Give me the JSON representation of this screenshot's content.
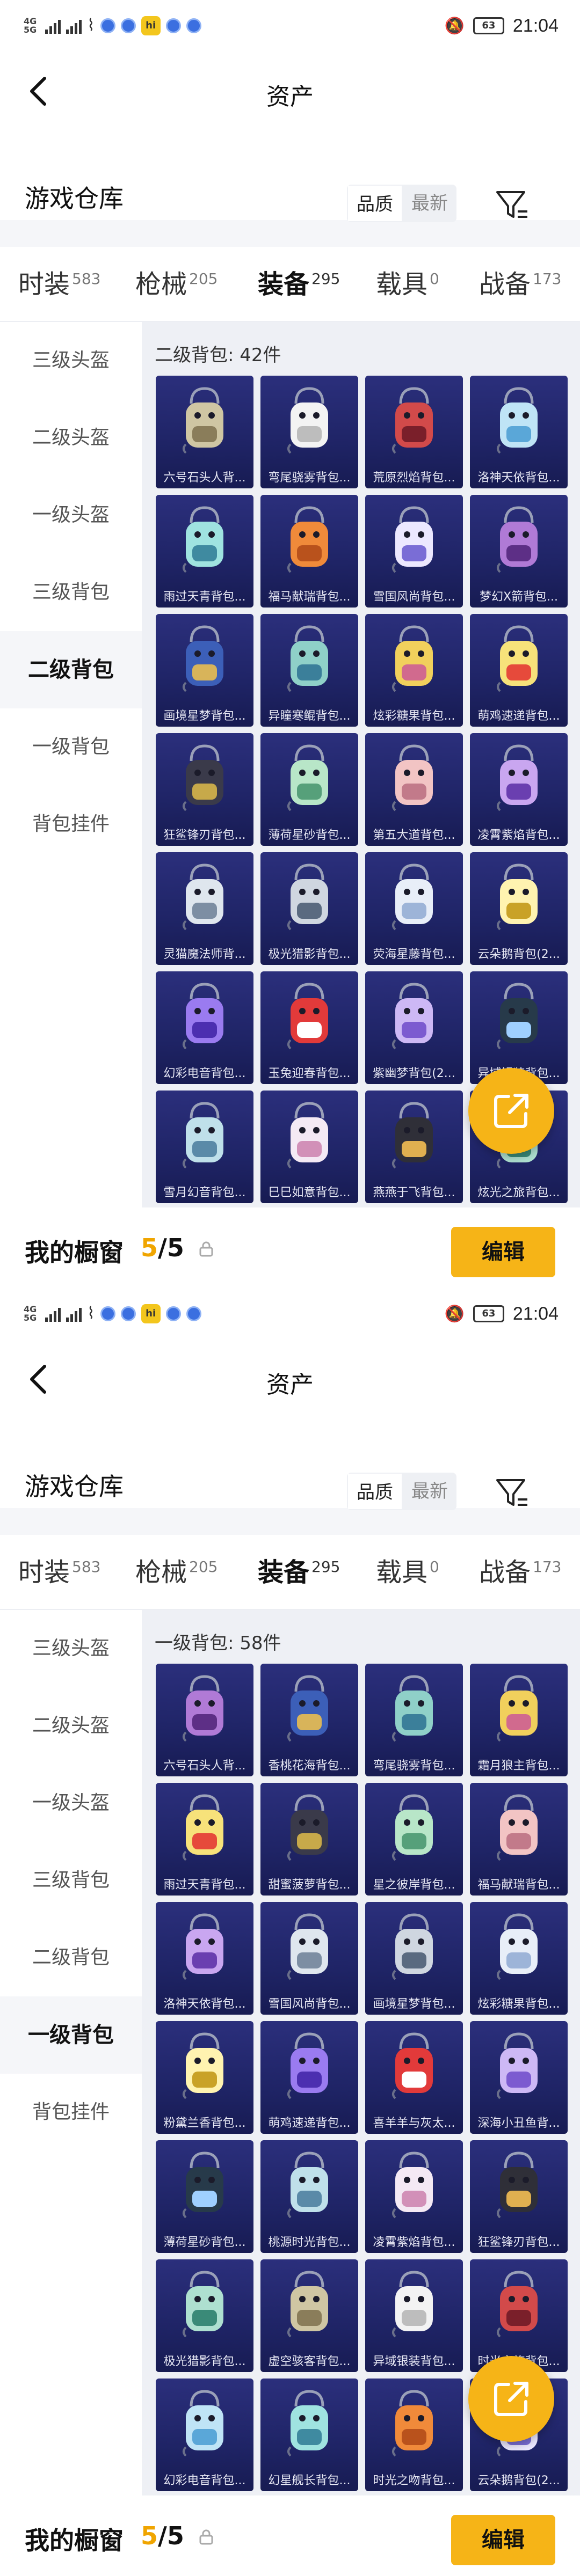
{
  "colors": {
    "accent": "#f6b417",
    "count_accent": "#f0a500",
    "card_top": "#2b2f7c",
    "card_bottom": "#171b52",
    "content_bg": "#eef0f5"
  },
  "screens": [
    {
      "status_bar": {
        "network": "4G 5G",
        "battery": "63",
        "time": "21:04",
        "app_icon_text": "hi"
      },
      "header": {
        "title": "资产",
        "back_icon": "chevron-left-icon"
      },
      "warehouse": {
        "title": "游戏仓库",
        "sort_options": [
          "品质",
          "最新"
        ],
        "sort_selected": "品质",
        "filter_icon": "filter-icon"
      },
      "tabs": [
        {
          "label": "时装",
          "count": "583"
        },
        {
          "label": "枪械",
          "count": "205"
        },
        {
          "label": "装备",
          "count": "295",
          "active": true
        },
        {
          "label": "载具",
          "count": "0"
        },
        {
          "label": "战备",
          "count": "173"
        }
      ],
      "side_nav": [
        {
          "label": "三级头盔"
        },
        {
          "label": "二级头盔"
        },
        {
          "label": "一级头盔"
        },
        {
          "label": "三级背包"
        },
        {
          "label": "二级背包",
          "active": true
        },
        {
          "label": "一级背包"
        },
        {
          "label": "背包挂件"
        }
      ],
      "category_label": "二级背包: 42件",
      "items": [
        "六号石头人背...",
        "弯尾骁雾背包...",
        "荒原烈焰背包...",
        "洛神天依背包...",
        "雨过天青背包...",
        "福马献瑞背包...",
        "雪国风尚背包...",
        "梦幻X箭背包...",
        "画境星梦背包...",
        "异瞳寒鲲背包...",
        "炫彩糖果背包...",
        "萌鸡速递背包...",
        "狂鲨锋刃背包...",
        "薄荷星砂背包...",
        "第五大道背包...",
        "凌霄紫焰背包...",
        "灵猫魔法师背...",
        "极光猎影背包...",
        "荧海星藤背包...",
        "云朵鹅背包(2...",
        "幻彩电音背包...",
        "玉兔迎春背包...",
        "紫幽梦背包(2...",
        "异域银装背包...",
        "雪月幻音背包...",
        "巳巳如意背包...",
        "燕燕于飞背包...",
        "炫光之旅背包..."
      ],
      "bottom": {
        "label": "我的橱窗",
        "count_current": "5",
        "count_separator": "/",
        "count_total": "5",
        "edit_label": "编辑"
      },
      "fab_icon": "share-icon"
    },
    {
      "status_bar": {
        "network": "4G 5G",
        "battery": "63",
        "time": "21:04",
        "app_icon_text": "hi"
      },
      "header": {
        "title": "资产",
        "back_icon": "chevron-left-icon"
      },
      "warehouse": {
        "title": "游戏仓库",
        "sort_options": [
          "品质",
          "最新"
        ],
        "sort_selected": "品质",
        "filter_icon": "filter-icon"
      },
      "tabs": [
        {
          "label": "时装",
          "count": "583"
        },
        {
          "label": "枪械",
          "count": "205"
        },
        {
          "label": "装备",
          "count": "295",
          "active": true
        },
        {
          "label": "载具",
          "count": "0"
        },
        {
          "label": "战备",
          "count": "173"
        }
      ],
      "side_nav": [
        {
          "label": "三级头盔"
        },
        {
          "label": "二级头盔"
        },
        {
          "label": "一级头盔"
        },
        {
          "label": "三级背包"
        },
        {
          "label": "二级背包"
        },
        {
          "label": "一级背包",
          "active": true
        },
        {
          "label": "背包挂件"
        }
      ],
      "category_label": "一级背包: 58件",
      "items": [
        "六号石头人背...",
        "香桃花海背包...",
        "弯尾骁雾背包...",
        "霜月狼主背包...",
        "雨过天青背包...",
        "甜蜜菠萝背包...",
        "星之彼岸背包...",
        "福马献瑞背包...",
        "洛神天依背包...",
        "雪国风尚背包...",
        "画境星梦背包...",
        "炫彩糖果背包...",
        "粉黛兰香背包...",
        "萌鸡速递背包...",
        "喜羊羊与灰太...",
        "深海小丑鱼背...",
        "薄荷星砂背包...",
        "桃源时光背包...",
        "凌霄紫焰背包...",
        "狂鲨锋刃背包...",
        "极光猎影背包...",
        "虚空骇客背包...",
        "异域银装背包...",
        "时光之旅背包...",
        "幻彩电音背包...",
        "幻星舰长背包...",
        "时光之吻背包...",
        "云朵鹅背包(2..."
      ],
      "bottom": {
        "label": "我的橱窗",
        "count_current": "5",
        "count_separator": "/",
        "count_total": "5",
        "edit_label": "编辑"
      },
      "fab_icon": "share-icon"
    }
  ]
}
